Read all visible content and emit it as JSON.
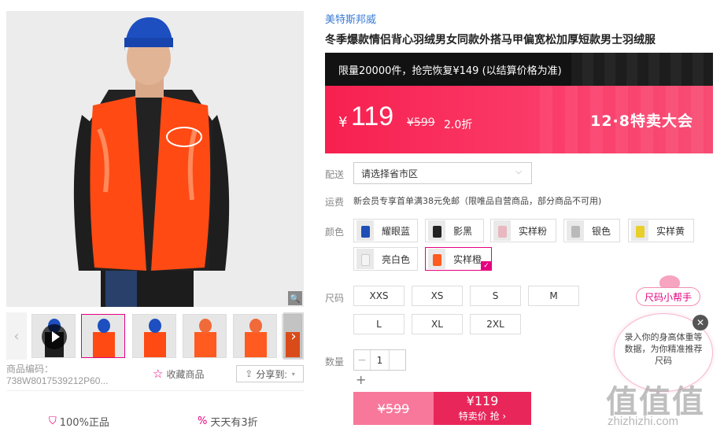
{
  "product": {
    "brand": "美特斯邦威",
    "title": "冬季爆款情侣背心羽绒男女同款外搭马甲偏宽松加厚短款男士羽绒服",
    "sku_code": "商品编码：738W8017539212P60...",
    "favorite_label": "收藏商品",
    "share_label": "分享到:"
  },
  "promo": {
    "banner_text": "限量20000件，抢完恢复¥149 (以结算价格为准)",
    "currency": "¥",
    "price": "119",
    "original_price": "¥599",
    "discount": "2.0折",
    "event_label": "12·8特卖大会"
  },
  "delivery": {
    "label": "配送",
    "placeholder": "请选择省市区"
  },
  "shipping": {
    "label": "运费",
    "text": "新会员专享首单满38元免邮（限唯品自营商品，部分商品不可用)"
  },
  "colors": {
    "label": "颜色",
    "options": [
      {
        "name": "耀眼蓝",
        "swatch": "#1f4fb5"
      },
      {
        "name": "影黑",
        "swatch": "#222222"
      },
      {
        "name": "实样粉",
        "swatch": "#e8b7c0"
      },
      {
        "name": "银色",
        "swatch": "#b9b9b9"
      },
      {
        "name": "实样黄",
        "swatch": "#e9cf2a"
      },
      {
        "name": "亮白色",
        "swatch": "#f4f4f4"
      },
      {
        "name": "实样橙",
        "swatch": "#ff5a1f",
        "selected": true
      }
    ]
  },
  "sizes": {
    "label": "尺码",
    "options": [
      "XXS",
      "XS",
      "S",
      "M",
      "L",
      "XL",
      "2XL"
    ]
  },
  "quantity": {
    "label": "数量",
    "value": "1",
    "minus": "−",
    "plus": "+"
  },
  "buy": {
    "original_price": "¥599",
    "price": "¥119",
    "label": "特卖价 抢 ›"
  },
  "size_helper": {
    "badge": "尺码小帮手",
    "text": "录入你的身高体重等数据，为你精准推荐尺码"
  },
  "guarantees": [
    {
      "label": "100%正品"
    },
    {
      "label": "天天有3折"
    }
  ],
  "watermark": {
    "logo": "值值值",
    "url": "zhizhizhi.com"
  }
}
